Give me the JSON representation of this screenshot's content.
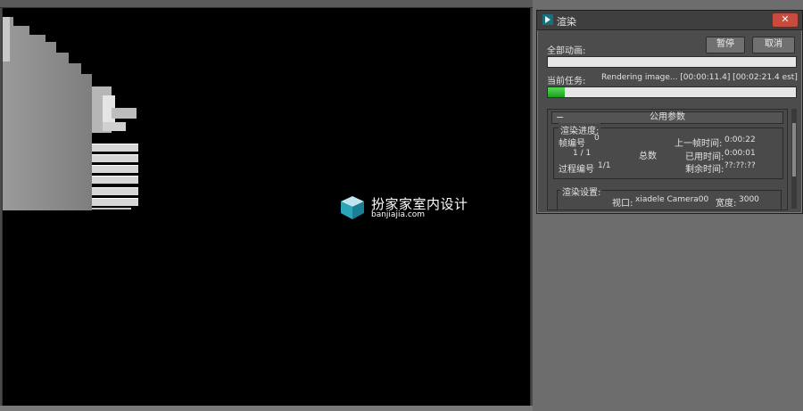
{
  "watermark": {
    "brand": "扮家家室内设计",
    "url": "banjiajia.com"
  },
  "dialog": {
    "title": "渲染",
    "close_label": "✕",
    "all_frames_label": "全部动画:",
    "pause_label": "暂停",
    "cancel_label": "取消",
    "current_task_label": "当前任务:",
    "current_task_value": "Rendering image... [00:00:11.4] [00:02:21.4 est]",
    "overall_progress": 0,
    "task_progress": 0.07,
    "rollout": {
      "toggle": "−",
      "title": "公用参数"
    },
    "progress_group": {
      "title": "渲染进度:",
      "frame_no_label": "帧编号",
      "frame_no_value": "0",
      "frame_count": "1  / 1",
      "total_label": "总数",
      "pass_label": "过程编号",
      "pass_value": "1/1",
      "last_frame_time_label": "上一帧时间:",
      "last_frame_time_value": "0:00:22",
      "elapsed_label": "已用时间:",
      "elapsed_value": "0:00:01",
      "remaining_label": "剩余时间:",
      "remaining_value": "??:??:??"
    },
    "settings_group": {
      "title": "渲染设置:",
      "viewport_label": "视口:",
      "viewport_value": "xiadele  Camera00",
      "width_label": "宽度:",
      "width_value": "3000"
    }
  },
  "colors": {
    "progress_green": "#2bb52b",
    "close_red": "#c84b3c"
  }
}
